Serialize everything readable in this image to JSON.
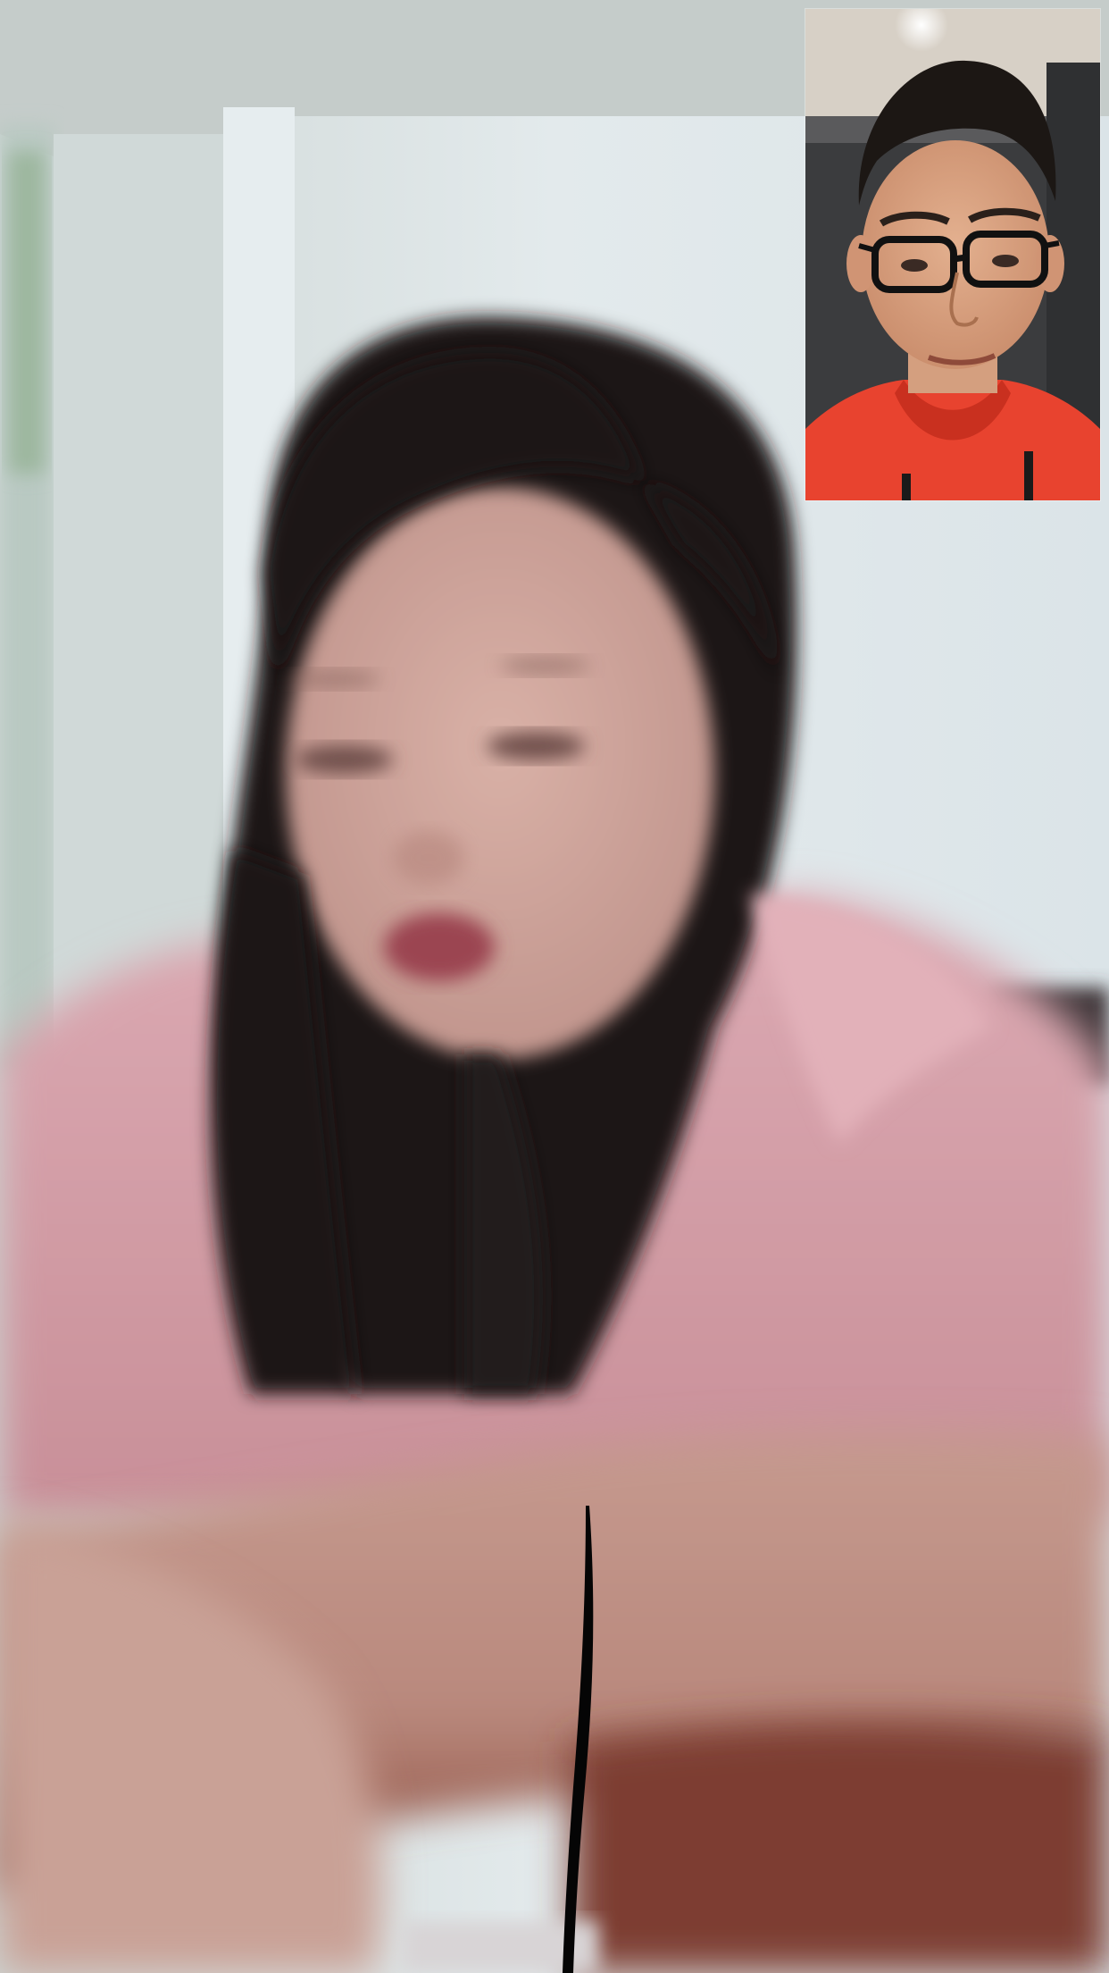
{
  "call": {
    "type": "video-call",
    "remote_feed_icon": "remote-camera-feed",
    "self_feed_icon": "self-camera-feed"
  },
  "colors": {
    "wall": "#dfe6e8",
    "ceiling": "#c9d0cf",
    "hair": "#1a1516",
    "robe_pink": "#d7a2ac",
    "skin": "#cfa69d",
    "self_hoodie": "#e8412e",
    "self_background": "#3a3b3d"
  }
}
